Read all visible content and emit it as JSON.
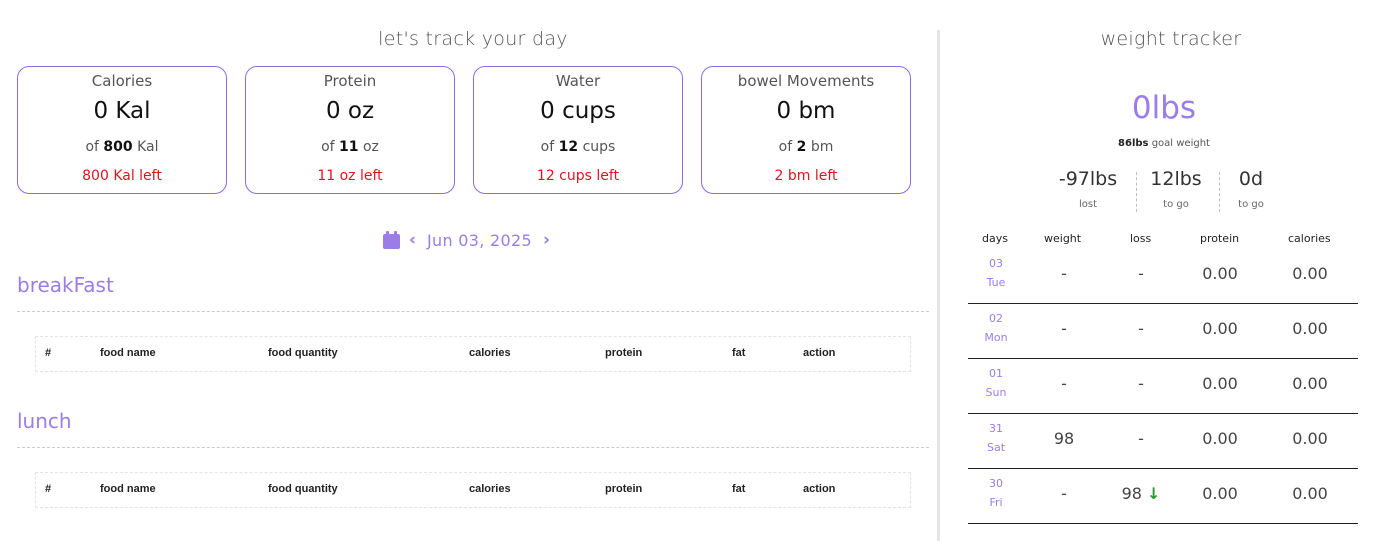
{
  "left": {
    "title": "let's track your day",
    "cards": [
      {
        "title": "Calories",
        "value": "0 Kal",
        "goal_prefix": "of",
        "goal_value": "800",
        "goal_unit": "Kal",
        "left": "800 Kal left"
      },
      {
        "title": "Protein",
        "value": "0 oz",
        "goal_prefix": "of",
        "goal_value": "11",
        "goal_unit": "oz",
        "left": "11 oz left"
      },
      {
        "title": "Water",
        "value": "0 cups",
        "goal_prefix": "of",
        "goal_value": "12",
        "goal_unit": "cups",
        "left": "12 cups left"
      },
      {
        "title": "bowel Movements",
        "value": "0 bm",
        "goal_prefix": "of",
        "goal_value": "2",
        "goal_unit": "bm",
        "left": "2 bm left"
      }
    ],
    "date_nav": {
      "date": "Jun 03, 2025",
      "prev": "‹",
      "next": "›"
    },
    "meals": [
      {
        "title": "breakFast"
      },
      {
        "title": "lunch"
      }
    ],
    "table_headers": [
      "#",
      "food name",
      "food quantity",
      "calories",
      "protein",
      "fat",
      "action"
    ]
  },
  "right": {
    "title": "weight tracker",
    "current_weight": "0lbs",
    "goal_value": "86lbs",
    "goal_label": "goal weight",
    "stats": [
      {
        "value": "-97lbs",
        "label": "lost"
      },
      {
        "value": "12lbs",
        "label": "to go"
      },
      {
        "value": "0d",
        "label": "to go"
      }
    ],
    "headers": [
      "days",
      "weight",
      "loss",
      "protein",
      "calories"
    ],
    "rows": [
      {
        "num": "03",
        "day": "Tue",
        "weight": "-",
        "loss": "-",
        "protein": "0.00",
        "calories": "0.00"
      },
      {
        "num": "02",
        "day": "Mon",
        "weight": "-",
        "loss": "-",
        "protein": "0.00",
        "calories": "0.00"
      },
      {
        "num": "01",
        "day": "Sun",
        "weight": "-",
        "loss": "-",
        "protein": "0.00",
        "calories": "0.00"
      },
      {
        "num": "31",
        "day": "Sat",
        "weight": "98",
        "loss": "-",
        "protein": "0.00",
        "calories": "0.00"
      },
      {
        "num": "30",
        "day": "Fri",
        "weight": "-",
        "loss": "98",
        "loss_arrow": "↓",
        "protein": "0.00",
        "calories": "0.00"
      }
    ]
  },
  "colors": {
    "accent": "#9b7ce8",
    "card_border": "#8c6be0",
    "remaining": "#e0141e",
    "down_arrow": "#2a9a2a"
  }
}
